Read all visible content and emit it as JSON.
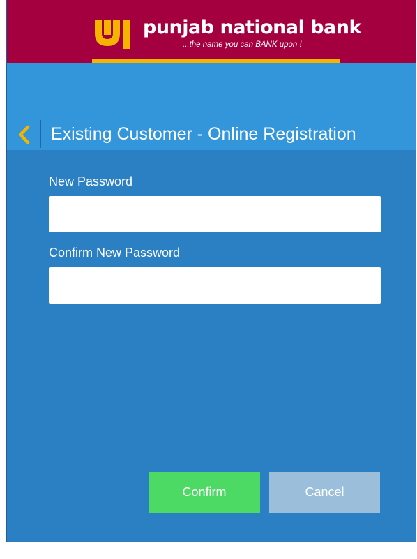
{
  "header": {
    "brand_name": "punjab national bank",
    "tagline": "...the name you can BANK upon !"
  },
  "title_bar": {
    "back_icon": "chevron-left-icon",
    "title": "Existing Customer - Online Registration"
  },
  "form": {
    "new_password": {
      "label": "New Password",
      "value": "",
      "placeholder": ""
    },
    "confirm_password": {
      "label": "Confirm New Password",
      "value": "",
      "placeholder": ""
    }
  },
  "actions": {
    "confirm_label": "Confirm",
    "cancel_label": "Cancel"
  },
  "colors": {
    "brand_maroon": "#a4003f",
    "brand_gold": "#f5b400",
    "background_blue": "#2a80c2",
    "header_blue": "#3496da",
    "confirm_green": "#4cd964",
    "cancel_gray_blue": "#9bbfdb"
  }
}
